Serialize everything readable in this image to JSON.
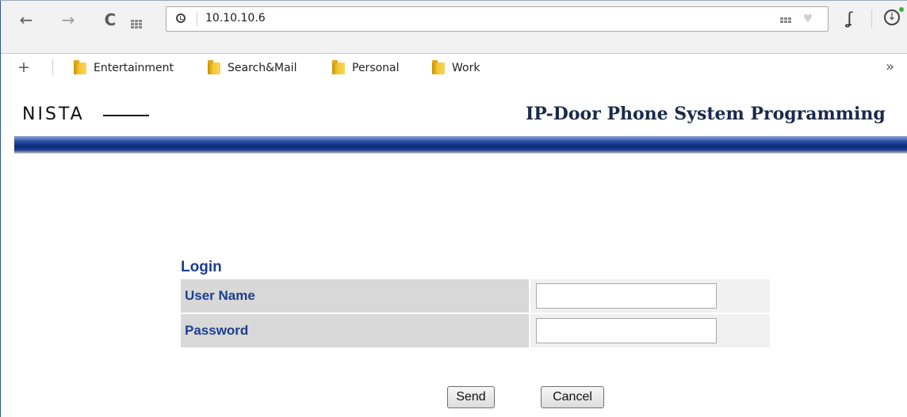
{
  "browser": {
    "url": "10.10.10.6",
    "bookmarks": [
      {
        "label": "Entertainment"
      },
      {
        "label": "Search&Mail"
      },
      {
        "label": "Personal"
      },
      {
        "label": "Work"
      }
    ],
    "icons": {
      "back": "back-arrow-icon",
      "forward": "forward-arrow-icon",
      "reload": "reload-icon",
      "apps": "apps-grid-icon",
      "page_info": "clock-icon",
      "add_bookmark": "plus-icon",
      "more_bookmarks": "chevron-double-right-icon"
    }
  },
  "page": {
    "logo": "NISTA",
    "title": "IP-Door Phone System Programming",
    "login": {
      "heading": "Login",
      "username_label": "User Name",
      "password_label": "Password",
      "username_value": "",
      "password_value": "",
      "send_label": "Send",
      "cancel_label": "Cancel"
    }
  },
  "colors": {
    "heading": "#1c3f8f",
    "label_bg": "#d8d8d8",
    "field_bg": "#f0f0f0",
    "bar_dark": "#0b2a7a"
  }
}
